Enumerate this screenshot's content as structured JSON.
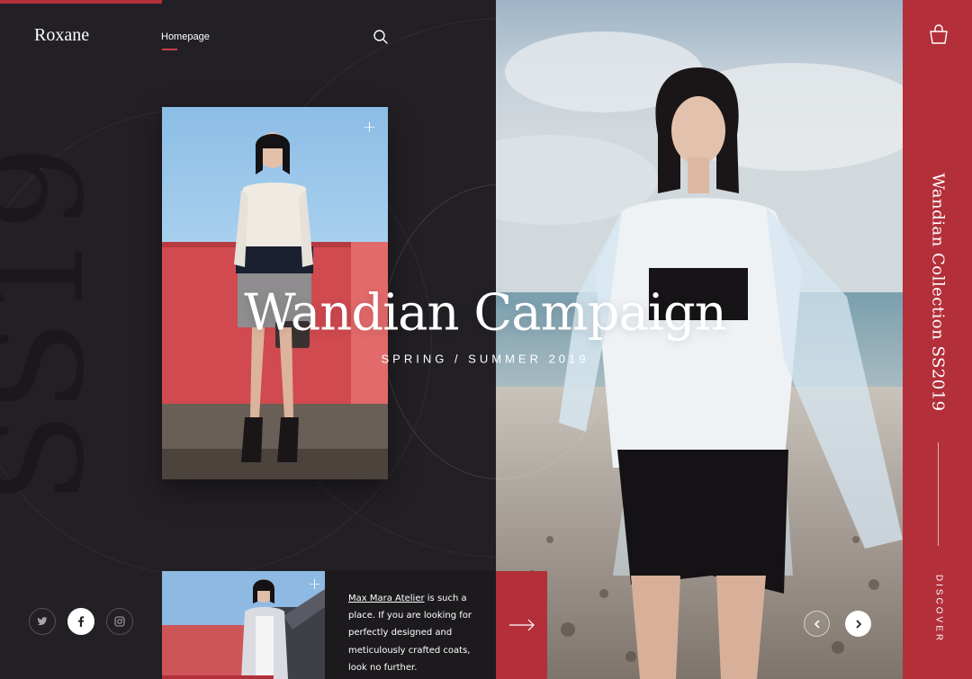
{
  "brand": {
    "logo": "Roxane"
  },
  "nav": {
    "home": "Homepage"
  },
  "hero": {
    "title": "Wandian Campaign",
    "subtitle": "SPRING / SUMMER 2019",
    "watermark": "SS19"
  },
  "teaser": {
    "link_text": "Max Mara Atelier",
    "body": " is such a place. If you are looking for perfectly designed and meticulously crafted coats, look no further."
  },
  "rail": {
    "collection": "Wandian Collection SS2019",
    "discover": "DISCOVER"
  },
  "social": [
    "twitter-icon",
    "facebook-icon",
    "instagram-icon"
  ],
  "colors": {
    "accent": "#b3303b",
    "dark": "#232025",
    "panel": "#1d1a1e"
  }
}
